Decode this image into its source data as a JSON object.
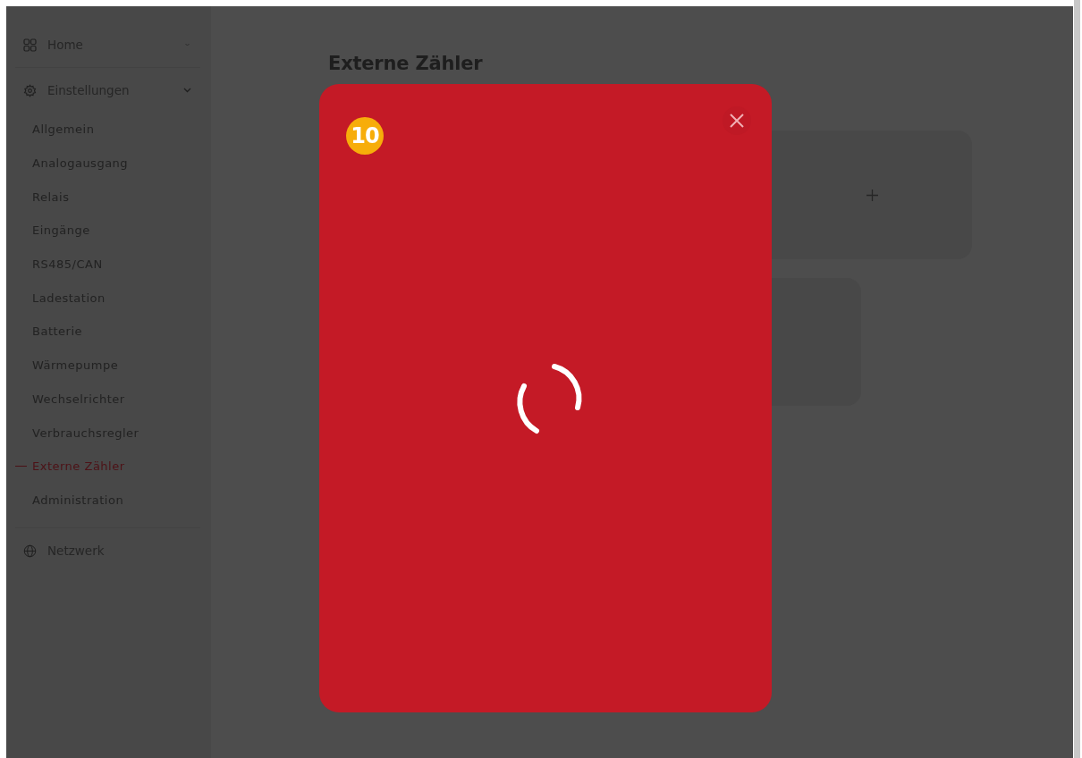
{
  "sidebar": {
    "groups": [
      {
        "label": "Home",
        "expanded": false
      },
      {
        "label": "Einstellungen",
        "expanded": true,
        "items": [
          {
            "label": "Allgemein",
            "selected": false
          },
          {
            "label": "Analogausgang",
            "selected": false
          },
          {
            "label": "Relais",
            "selected": false
          },
          {
            "label": "Eingänge",
            "selected": false
          },
          {
            "label": "RS485/CAN",
            "selected": false
          },
          {
            "label": "Ladestation",
            "selected": false
          },
          {
            "label": "Batterie",
            "selected": false
          },
          {
            "label": "Wärmepumpe",
            "selected": false
          },
          {
            "label": "Wechselrichter",
            "selected": false
          },
          {
            "label": "Verbrauchsregler",
            "selected": false
          },
          {
            "label": "Externe Zähler",
            "selected": true
          },
          {
            "label": "Administration",
            "selected": false
          }
        ]
      },
      {
        "label": "Netzwerk"
      }
    ]
  },
  "main": {
    "title": "Externe Zähler"
  },
  "modal": {
    "badge": "10"
  }
}
